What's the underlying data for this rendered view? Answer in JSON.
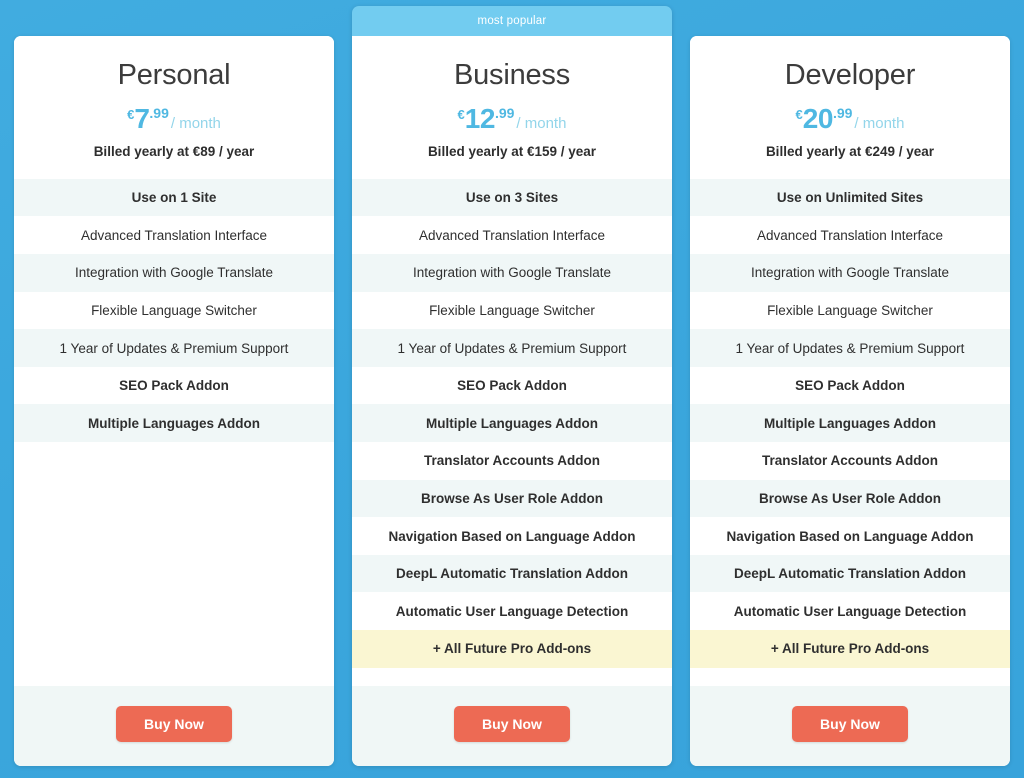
{
  "badge": {
    "label": "most popular"
  },
  "currency_symbol": "€",
  "per_label": "/ month",
  "plans": [
    {
      "name": "Personal",
      "amount": "7",
      "cents": ".99",
      "billed": "Billed yearly at €89 / year",
      "features": [
        {
          "label": "Use on 1 Site",
          "bold": true
        },
        {
          "label": "Advanced Translation Interface",
          "bold": false
        },
        {
          "label": "Integration with Google Translate",
          "bold": false
        },
        {
          "label": "Flexible Language Switcher",
          "bold": false
        },
        {
          "label": "1 Year of Updates & Premium Support",
          "bold": false
        },
        {
          "label": "SEO Pack Addon",
          "bold": true
        },
        {
          "label": "Multiple Languages Addon",
          "bold": true
        }
      ],
      "highlight_row": null,
      "buy_label": "Buy Now"
    },
    {
      "name": "Business",
      "amount": "12",
      "cents": ".99",
      "billed": "Billed yearly at €159 / year",
      "features": [
        {
          "label": "Use on 3 Sites",
          "bold": true
        },
        {
          "label": "Advanced Translation Interface",
          "bold": false
        },
        {
          "label": "Integration with Google Translate",
          "bold": false
        },
        {
          "label": "Flexible Language Switcher",
          "bold": false
        },
        {
          "label": "1 Year of Updates & Premium Support",
          "bold": false
        },
        {
          "label": "SEO Pack Addon",
          "bold": true
        },
        {
          "label": "Multiple Languages Addon",
          "bold": true
        },
        {
          "label": "Translator Accounts Addon",
          "bold": true
        },
        {
          "label": "Browse As User Role Addon",
          "bold": true
        },
        {
          "label": "Navigation Based on Language Addon",
          "bold": true
        },
        {
          "label": "DeepL Automatic Translation Addon",
          "bold": true
        },
        {
          "label": "Automatic User Language Detection",
          "bold": true
        },
        {
          "label": "+ All Future Pro Add-ons",
          "bold": true
        }
      ],
      "highlight_row": 12,
      "buy_label": "Buy Now"
    },
    {
      "name": "Developer",
      "amount": "20",
      "cents": ".99",
      "billed": "Billed yearly at €249 / year",
      "features": [
        {
          "label": "Use on Unlimited Sites",
          "bold": true
        },
        {
          "label": "Advanced Translation Interface",
          "bold": false
        },
        {
          "label": "Integration with Google Translate",
          "bold": false
        },
        {
          "label": "Flexible Language Switcher",
          "bold": false
        },
        {
          "label": "1 Year of Updates & Premium Support",
          "bold": false
        },
        {
          "label": "SEO Pack Addon",
          "bold": true
        },
        {
          "label": "Multiple Languages Addon",
          "bold": true
        },
        {
          "label": "Translator Accounts Addon",
          "bold": true
        },
        {
          "label": "Browse As User Role Addon",
          "bold": true
        },
        {
          "label": "Navigation Based on Language Addon",
          "bold": true
        },
        {
          "label": "DeepL Automatic Translation Addon",
          "bold": true
        },
        {
          "label": "Automatic User Language Detection",
          "bold": true
        },
        {
          "label": "+ All Future Pro Add-ons",
          "bold": true
        }
      ],
      "highlight_row": 12,
      "buy_label": "Buy Now"
    }
  ],
  "colors": {
    "background_blue": "#3BA7DD",
    "ribbon_blue": "#72CCF0",
    "price_blue": "#4FB8E2",
    "per_blue": "#93D5EA",
    "buy_button": "#ED6A54",
    "row_alt": "#F0F7F7",
    "row_highlight": "#FAF6D2",
    "footer": "#F0F7F6"
  }
}
